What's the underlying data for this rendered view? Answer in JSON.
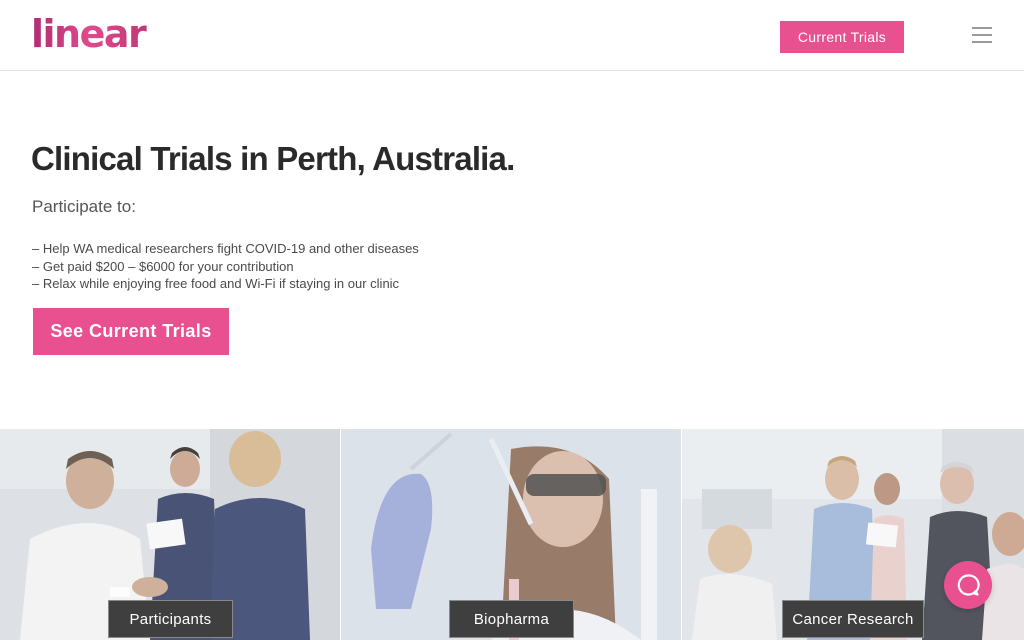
{
  "brand": {
    "logo_text": "linear",
    "accent": "#e8508f"
  },
  "header": {
    "cta_label": "Current Trials",
    "menu_icon": "hamburger-menu-icon"
  },
  "hero": {
    "title": "Clinical Trials in Perth, Australia.",
    "subtitle": "Participate to:",
    "bullets": [
      "– Help WA medical researchers fight COVID-19 and other diseases",
      "– Get paid $200 – $6000 for your contribution",
      "– Relax while enjoying free food and Wi-Fi if staying in our clinic"
    ],
    "cta_label": "See Current Trials"
  },
  "tiles": [
    {
      "label": "Participants"
    },
    {
      "label": "Biopharma"
    },
    {
      "label": "Cancer Research"
    }
  ],
  "chat": {
    "icon": "chat-bubble-icon"
  }
}
